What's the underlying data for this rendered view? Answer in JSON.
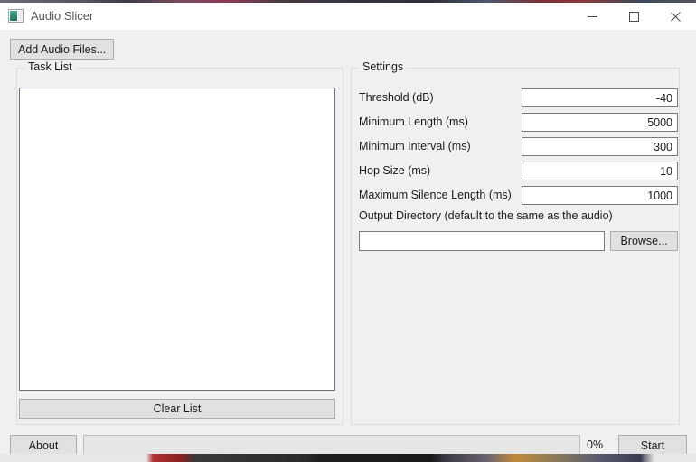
{
  "window": {
    "title": "Audio Slicer",
    "icon": "app-window-icon",
    "controls": {
      "minimize": "minimize-icon",
      "maximize": "maximize-icon",
      "close": "close-icon"
    }
  },
  "toolbar": {
    "add_audio_files": "Add Audio Files..."
  },
  "task_panel": {
    "title": "Task List",
    "list_items": [],
    "clear_list": "Clear List"
  },
  "settings_panel": {
    "title": "Settings",
    "rows": [
      {
        "label": "Threshold (dB)",
        "value": "-40"
      },
      {
        "label": "Minimum Length (ms)",
        "value": "5000"
      },
      {
        "label": "Minimum Interval (ms)",
        "value": "300"
      },
      {
        "label": "Hop Size (ms)",
        "value": "10"
      },
      {
        "label": "Maximum Silence Length (ms)",
        "value": "1000"
      }
    ],
    "output_directory": {
      "label": "Output Directory (default to the same as the audio)",
      "value": "",
      "placeholder": "",
      "browse": "Browse..."
    }
  },
  "status_bar": {
    "about": "About",
    "progress_percent_label": "0%",
    "progress_value": 0,
    "start": "Start"
  },
  "colors": {
    "window_bg": "#f0f0f0",
    "titlebar_bg": "#ffffff",
    "button_bg": "#e1e1e1",
    "button_border": "#adadad",
    "field_bg": "#ffffff",
    "field_border": "#7a7a7a",
    "group_border": "#dcdcdc",
    "text": "#1a1a1a",
    "title_text": "#58595b",
    "progress_track": "#e6e6e6"
  }
}
